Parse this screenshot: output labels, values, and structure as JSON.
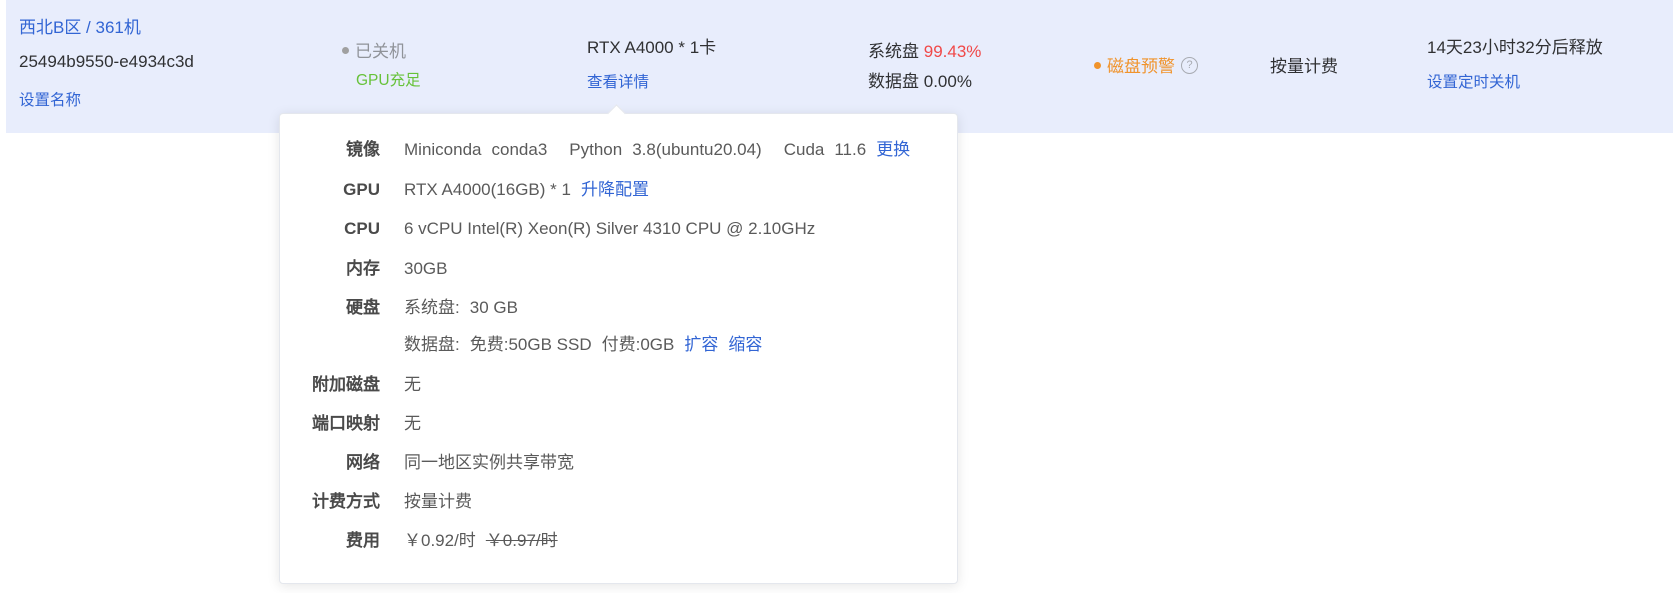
{
  "instance": {
    "region": "西北B区 / 361机",
    "id": "25494b9550-e4934c3d",
    "set_name": "设置名称",
    "status": "已关机",
    "gpu_status": "GPU充足",
    "gpu": "RTX A4000 * 1卡",
    "view_detail": "查看详情",
    "sys_disk_label": "系统盘",
    "sys_disk_value": "99.43%",
    "data_disk_label": "数据盘",
    "data_disk_value": "0.00%",
    "disk_warning": "磁盘预警",
    "billing": "按量计费",
    "release_time": "14天23小时32分后释放",
    "set_shutdown": "设置定时关机"
  },
  "colors": {
    "row_bg": "#e8edfc",
    "link": "#3265d4",
    "warning": "#f0932b",
    "danger": "#f04848",
    "success": "#67c23a"
  },
  "detail": {
    "image_label": "镜像",
    "image_miniconda": "Miniconda",
    "image_conda": "conda3",
    "image_python_label": "Python",
    "image_python": "3.8(ubuntu20.04)",
    "image_cuda_label": "Cuda",
    "image_cuda": "11.6",
    "image_change": "更换",
    "gpu_label": "GPU",
    "gpu_value": "RTX A4000(16GB) * 1",
    "gpu_upgrade": "升降配置",
    "cpu_label": "CPU",
    "cpu_value": "6 vCPU Intel(R) Xeon(R) Silver 4310 CPU @ 2.10GHz",
    "memory_label": "内存",
    "memory_value": "30GB",
    "disk_label": "硬盘",
    "disk_sys_label": "系统盘:",
    "disk_sys_value": "30 GB",
    "disk_data_label": "数据盘:",
    "disk_data_free": "免费:50GB SSD",
    "disk_data_paid": "付费:0GB",
    "disk_expand": "扩容",
    "disk_shrink": "缩容",
    "extra_disk_label": "附加磁盘",
    "extra_disk_value": "无",
    "port_label": "端口映射",
    "port_value": "无",
    "network_label": "网络",
    "network_value": "同一地区实例共享带宽",
    "billing_label": "计费方式",
    "billing_value": "按量计费",
    "cost_label": "费用",
    "cost_value": "￥0.92/时",
    "cost_original": "￥0.97/时"
  }
}
